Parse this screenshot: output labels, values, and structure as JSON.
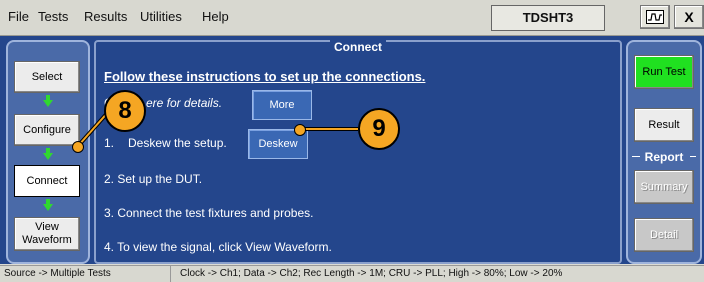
{
  "menu": [
    "File",
    "Tests",
    "Results",
    "Utilities",
    "Help"
  ],
  "model": "TDSHT3",
  "window_buttons": {
    "scope_icon": "scope-icon",
    "close": "X"
  },
  "content_title": "Connect",
  "nav": [
    {
      "label": "Select"
    },
    {
      "label": "Configure"
    },
    {
      "label": "Connect"
    },
    {
      "label": "View Waveform"
    }
  ],
  "instructions_heading": "Follow these instructions to set up the connections.",
  "steps": {
    "s1a": "C",
    "s1b": "ere for details.",
    "s2": "Deskew the setup.",
    "s2a": "1.",
    "s3": "2. Set up the DUT.",
    "s4": "3. Connect the test fixtures and probes.",
    "s5": "4. To view the signal, click View Waveform."
  },
  "buttons": {
    "more": "More",
    "deskew": "Deskew"
  },
  "right": {
    "run": "Run Test",
    "result": "Result",
    "report_label": "Report",
    "summary": "Summary",
    "detail": "Detail"
  },
  "callouts": {
    "c8": "8",
    "c9": "9"
  },
  "status": {
    "left": "Source -> Multiple Tests",
    "right": "Clock -> Ch1; Data -> Ch2; Rec Length -> 1M; CRU -> PLL; High -> 80%; Low -> 20%"
  },
  "colors": {
    "panel": "#24468c",
    "run_button": "#20e020",
    "callout": "#f5a623",
    "arrow": "#30d830"
  }
}
